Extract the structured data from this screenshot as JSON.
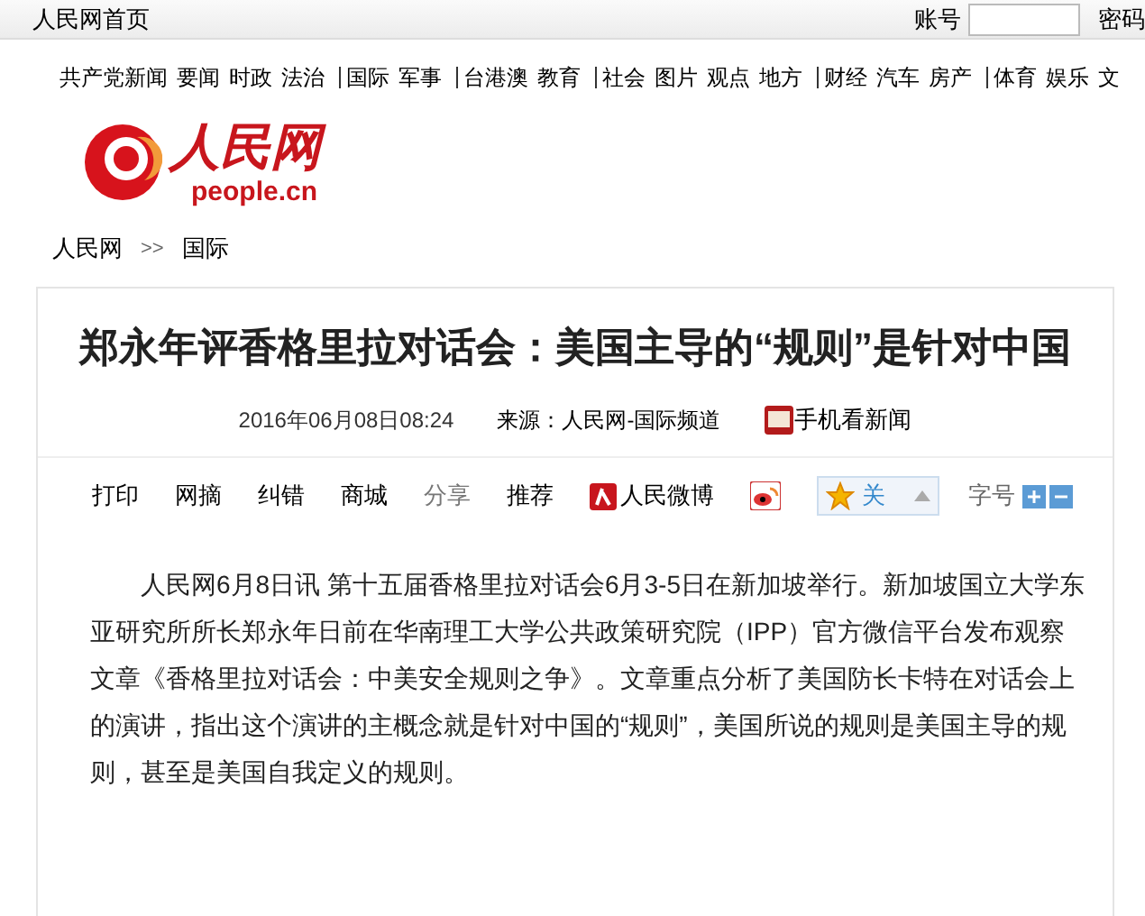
{
  "top_bar": {
    "home_link": "人民网首页",
    "account_label": "账号",
    "password_label": "密码"
  },
  "nav": [
    [
      "共产党新闻",
      "要闻",
      "时政",
      "法治"
    ],
    [
      "国际",
      "军事"
    ],
    [
      "台港澳",
      "教育"
    ],
    [
      "社会",
      "图片",
      "观点",
      "地方"
    ],
    [
      "财经",
      "汽车",
      "房产"
    ],
    [
      "体育",
      "娱乐",
      "文"
    ]
  ],
  "logo": {
    "wordmark": "人民网",
    "domain": "people.cn"
  },
  "breadcrumb": {
    "items": [
      "人民网",
      "国际"
    ],
    "separator": ">>"
  },
  "article": {
    "title": "郑永年评香格里拉对话会：美国主导的“规则”是针对中国",
    "date": "2016年06月08日08:24",
    "source": "来源：人民网-国际频道",
    "mobile_link": "手机看新闻",
    "toolbar": [
      {
        "kind": "link",
        "label": "打印"
      },
      {
        "kind": "link",
        "label": "网摘"
      },
      {
        "kind": "link",
        "label": "纠错"
      },
      {
        "kind": "link",
        "label": "商城"
      },
      {
        "kind": "text",
        "label": "分享"
      },
      {
        "kind": "link",
        "label": "推荐"
      },
      {
        "kind": "brand",
        "label": "人民微博"
      },
      {
        "kind": "weibo"
      },
      {
        "kind": "follow",
        "label": "关"
      }
    ],
    "font_size_label": "字号",
    "body": "人民网6月8日讯 第十五届香格里拉对话会6月3-5日在新加坡举行。新加坡国立大学东亚研究所所长郑永年日前在华南理工大学公共政策研究院（IPP）官方微信平台发布观察文章《香格里拉对话会：中美安全规则之争》。文章重点分析了美国防长卡特在对话会上的演讲，指出这个演讲的主概念就是针对中国的“规则”，美国所说的规则是美国主导的规则，甚至是美国自我定义的规则。"
  }
}
